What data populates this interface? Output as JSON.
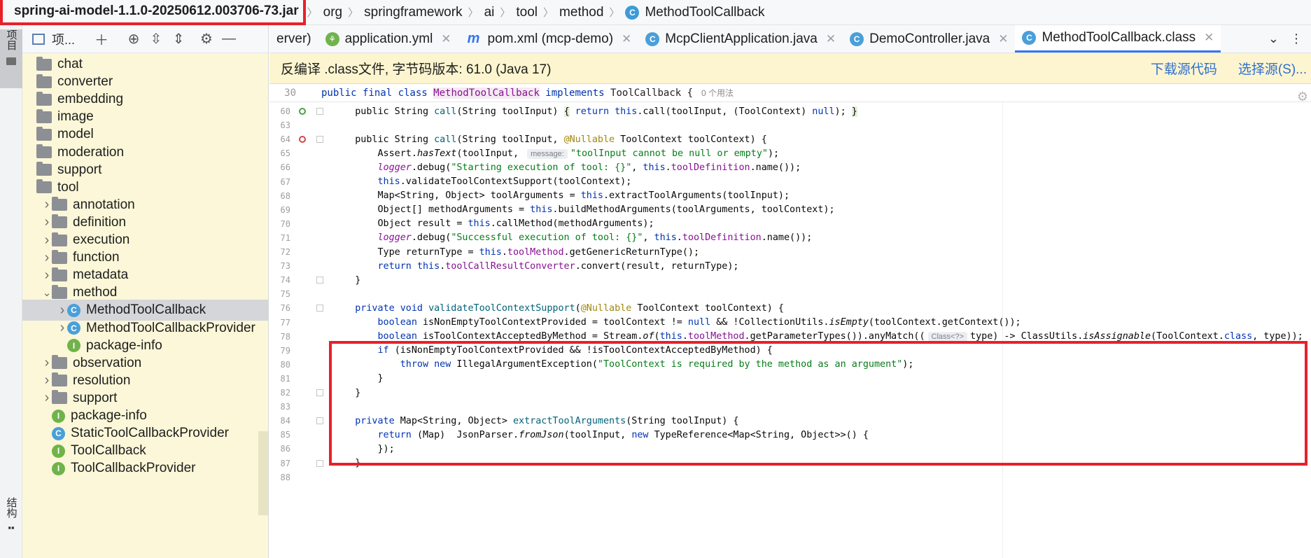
{
  "breadcrumb": {
    "jar": "spring-ai-model-1.1.0-20250612.003706-73.jar",
    "parts": [
      "org",
      "springframework",
      "ai",
      "tool",
      "method"
    ],
    "class_name": "MethodToolCallback"
  },
  "left_strip": {
    "project_label": "项目",
    "structure_label": "结构"
  },
  "project_panel": {
    "title": "项...",
    "tree": [
      {
        "label": "chat",
        "type": "folder",
        "chevron": false,
        "indent": 0
      },
      {
        "label": "converter",
        "type": "folder",
        "chevron": false,
        "indent": 0
      },
      {
        "label": "embedding",
        "type": "folder",
        "chevron": false,
        "indent": 0
      },
      {
        "label": "image",
        "type": "folder",
        "chevron": false,
        "indent": 0
      },
      {
        "label": "model",
        "type": "folder",
        "chevron": false,
        "indent": 0
      },
      {
        "label": "moderation",
        "type": "folder",
        "chevron": false,
        "indent": 0
      },
      {
        "label": "support",
        "type": "folder",
        "chevron": false,
        "indent": 0
      },
      {
        "label": "tool",
        "type": "folder",
        "chevron": false,
        "indent": 0
      },
      {
        "label": "annotation",
        "type": "folder",
        "chevron": "right",
        "indent": 1
      },
      {
        "label": "definition",
        "type": "folder",
        "chevron": "right",
        "indent": 1
      },
      {
        "label": "execution",
        "type": "folder",
        "chevron": "right",
        "indent": 1
      },
      {
        "label": "function",
        "type": "folder",
        "chevron": "right",
        "indent": 1
      },
      {
        "label": "metadata",
        "type": "folder",
        "chevron": "right",
        "indent": 1
      },
      {
        "label": "method",
        "type": "folder",
        "chevron": "down",
        "indent": 1
      },
      {
        "label": "MethodToolCallback",
        "type": "class",
        "chevron": "right",
        "indent": 2,
        "selected": true
      },
      {
        "label": "MethodToolCallbackProvider",
        "type": "class",
        "chevron": "right",
        "indent": 2
      },
      {
        "label": "package-info",
        "type": "info",
        "chevron": false,
        "indent": 2
      },
      {
        "label": "observation",
        "type": "folder",
        "chevron": "right",
        "indent": 1
      },
      {
        "label": "resolution",
        "type": "folder",
        "chevron": "right",
        "indent": 1
      },
      {
        "label": "support",
        "type": "folder",
        "chevron": "right",
        "indent": 1
      },
      {
        "label": "package-info",
        "type": "info",
        "chevron": false,
        "indent": 1
      },
      {
        "label": "StaticToolCallbackProvider",
        "type": "class",
        "chevron": false,
        "indent": 1
      },
      {
        "label": "ToolCallback",
        "type": "info",
        "chevron": false,
        "indent": 1
      },
      {
        "label": "ToolCallbackProvider",
        "type": "info",
        "chevron": false,
        "indent": 1
      }
    ]
  },
  "tabs": [
    {
      "label": "erver)",
      "icon": "none",
      "closable": false
    },
    {
      "label": "application.yml",
      "icon": "yml",
      "closable": true
    },
    {
      "label": "pom.xml (mcp-demo)",
      "icon": "m",
      "closable": true
    },
    {
      "label": "McpClientApplication.java",
      "icon": "c",
      "closable": true
    },
    {
      "label": "DemoController.java",
      "icon": "c",
      "closable": true
    },
    {
      "label": "MethodToolCallback.class",
      "icon": "c",
      "closable": true,
      "active": true
    }
  ],
  "banner": {
    "text": "反编译 .class文件, 字节码版本: 61.0 (Java 17)",
    "download_source": "下载源代码",
    "choose_source": "选择源(S)..."
  },
  "sticky": {
    "line": "30",
    "code": "public final class MethodToolCallback implements ToolCallback {",
    "usage": "0 个用法"
  },
  "code_lines": [
    {
      "n": "60",
      "mark": "override"
    },
    {
      "n": "63"
    },
    {
      "n": "64",
      "mark": "override-red"
    },
    {
      "n": "65"
    },
    {
      "n": "66"
    },
    {
      "n": "67"
    },
    {
      "n": "68"
    },
    {
      "n": "69"
    },
    {
      "n": "70"
    },
    {
      "n": "71"
    },
    {
      "n": "72"
    },
    {
      "n": "73"
    },
    {
      "n": "74"
    },
    {
      "n": "75"
    },
    {
      "n": "76"
    },
    {
      "n": "77"
    },
    {
      "n": "78"
    },
    {
      "n": "79"
    },
    {
      "n": "80"
    },
    {
      "n": "81"
    },
    {
      "n": "82"
    },
    {
      "n": "83"
    },
    {
      "n": "84"
    },
    {
      "n": "85"
    },
    {
      "n": "86"
    },
    {
      "n": "87"
    },
    {
      "n": "88"
    }
  ],
  "code_text": {
    "l60_a": "    public String ",
    "l60_b": "call",
    "l60_c": "(String toolInput) ",
    "l60_d": "{",
    "l60_e": " return ",
    "l60_f": "this",
    "l60_g": ".call(toolInput, (ToolContext) ",
    "l60_h": "null",
    "l60_i": "); ",
    "l60_j": "}",
    "l64_a": "    public String ",
    "l64_b": "call",
    "l64_c": "(String toolInput, ",
    "l64_d": "@Nullable",
    "l64_e": " ToolContext toolContext) {",
    "l65_a": "        Assert.",
    "l65_b": "hasText",
    "l65_c": "(toolInput, ",
    "l65_hint": "message:",
    "l65_d": "\"toolInput cannot be null or empty\"",
    "l65_e": ");",
    "l66_a": "logger",
    "l66_b": ".debug(",
    "l66_c": "\"Starting execution of tool: {}\"",
    "l66_d": ", ",
    "l66_e": "this",
    "l66_f": ".",
    "l66_g": "toolDefinition",
    "l66_h": ".name());",
    "l67_a": "this",
    "l67_b": ".validateToolContextSupport(toolContext);",
    "l68_a": "        Map<String, Object> toolArguments = ",
    "l68_b": "this",
    "l68_c": ".extractToolArguments(toolInput);",
    "l69_a": "        Object[] methodArguments = ",
    "l69_b": "this",
    "l69_c": ".buildMethodArguments(toolArguments, toolContext);",
    "l70_a": "        Object result = ",
    "l70_b": "this",
    "l70_c": ".callMethod(methodArguments);",
    "l71_a": "logger",
    "l71_b": ".debug(",
    "l71_c": "\"Successful execution of tool: {}\"",
    "l71_d": ", ",
    "l71_e": "this",
    "l71_f": ".",
    "l71_g": "toolDefinition",
    "l71_h": ".name());",
    "l72_a": "        Type returnType = ",
    "l72_b": "this",
    "l72_c": ".",
    "l72_d": "toolMethod",
    "l72_e": ".getGenericReturnType();",
    "l73_a": "return ",
    "l73_b": "this",
    "l73_c": ".",
    "l73_d": "toolCallResultConverter",
    "l73_e": ".convert(result, returnType);",
    "l74": "    }",
    "l76_a": "private void ",
    "l76_b": "validateToolContextSupport",
    "l76_c": "(",
    "l76_d": "@Nullable",
    "l76_e": " ToolContext toolContext) {",
    "l77_a": "boolean ",
    "l77_b": "isNonEmptyToolContextProvided = toolContext != ",
    "l77_c": "null",
    "l77_d": " && !CollectionUtils.",
    "l77_e": "isEmpty",
    "l77_f": "(toolContext.getContext());",
    "l78_a": "boolean ",
    "l78_b": "isToolContextAcceptedByMethod = Stream.",
    "l78_c": "of",
    "l78_d": "(",
    "l78_e": "this",
    "l78_f": ".",
    "l78_g": "toolMethod",
    "l78_h": ".getParameterTypes()).anyMatch((",
    "l78_hint": "Class<?>",
    "l78_i": "type) -> ClassUtils.",
    "l78_j": "isAssignable",
    "l78_k": "(ToolContext.",
    "l78_l": "class",
    "l78_m": ", type));",
    "l79_a": "if ",
    "l79_b": "(isNonEmptyToolContextProvided && !isToolContextAcceptedByMethod) {",
    "l80_a": "throw new ",
    "l80_b": "IllegalArgumentException(",
    "l80_c": "\"ToolContext is required by the method as an argument\"",
    "l80_d": ");",
    "l81": "        }",
    "l82": "    }",
    "l84_a": "private ",
    "l84_b": "Map<String, Object> ",
    "l84_c": "extractToolArguments",
    "l84_d": "(String toolInput) {",
    "l85_a": "return ",
    "l85_b": "(Map)  JsonParser.",
    "l85_c": "fromJson",
    "l85_d": "(toolInput, ",
    "l85_e": "new ",
    "l85_f": "TypeReference<Map<String, Object>>() {",
    "l86": "        });",
    "l87": "    }"
  },
  "colors": {
    "highlight_border": "#e8202a",
    "active_tab": "#3574f0",
    "keyword": "#0033b3",
    "string": "#067d17",
    "field": "#871094",
    "method": "#00627a",
    "annotation": "#9e880d"
  }
}
